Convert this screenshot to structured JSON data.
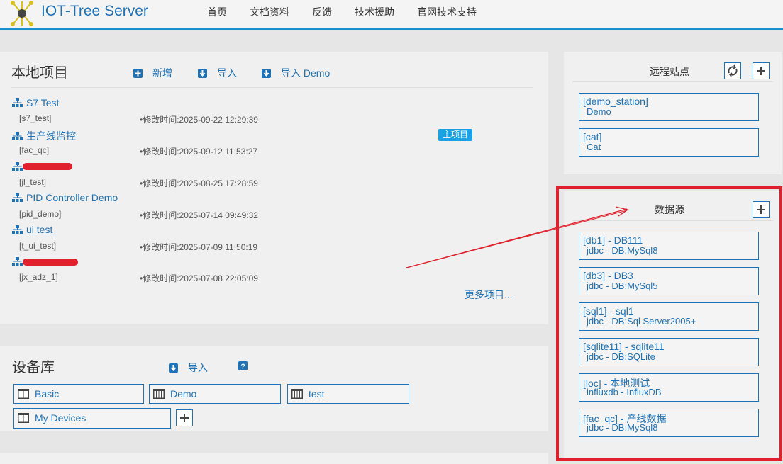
{
  "header": {
    "app_title": "IOT-Tree Server",
    "nav": [
      "首页",
      "文档资料",
      "反馈",
      "技术援助",
      "官网技术支持"
    ]
  },
  "local_projects": {
    "title": "本地项目",
    "tools": {
      "add": "新增",
      "import": "导入",
      "import_demo": "导入 Demo"
    },
    "main_badge": "主项目",
    "items": [
      {
        "name": "S7 Test",
        "id": "[s7_test]",
        "time": "•修改时间:2025-09-22 12:29:39"
      },
      {
        "name": "生产线监控",
        "id": "[fac_qc]",
        "time": "•修改时间:2025-09-12 11:53:27"
      },
      {
        "name": "",
        "id": "[jl_test]",
        "time": "•修改时间:2025-08-25 17:28:59"
      },
      {
        "name": "PID Controller Demo",
        "id": "[pid_demo]",
        "time": "•修改时间:2025-07-14 09:49:32"
      },
      {
        "name": "ui test",
        "id": "[t_ui_test]",
        "time": "•修改时间:2025-07-09 11:50:19"
      },
      {
        "name": "",
        "id": "[jx_adz_1]",
        "time": "•修改时间:2025-07-08 22:05:09"
      }
    ],
    "more": "更多项目..."
  },
  "device_library": {
    "title": "设备库",
    "import": "导入",
    "items": [
      "Basic",
      "Demo",
      "test",
      "My Devices"
    ]
  },
  "remote_stations": {
    "title": "远程站点",
    "items": [
      {
        "line1": "[demo_station]",
        "line2": "Demo"
      },
      {
        "line1": "[cat]",
        "line2": "Cat"
      }
    ]
  },
  "data_sources": {
    "title": "数据源",
    "items": [
      {
        "line1": "[db1] - DB111",
        "line2": "jdbc - DB:MySql8"
      },
      {
        "line1": "[db3] - DB3",
        "line2": "jdbc - DB:MySql5"
      },
      {
        "line1": "[sql1] - sql1",
        "line2": "jdbc - DB:Sql Server2005+"
      },
      {
        "line1": "[sqlite11] - sqlite11",
        "line2": "jdbc - DB:SQLite"
      },
      {
        "line1": "[loc] - 本地测试",
        "line2": "influxdb - InfluxDB"
      },
      {
        "line1": "[fac_qc] - 产线数据",
        "line2": "jdbc - DB:MySql8"
      }
    ]
  },
  "colors": {
    "accent": "#1f72b6",
    "highlight": "#e0202c",
    "badge": "#1aa1e6"
  }
}
